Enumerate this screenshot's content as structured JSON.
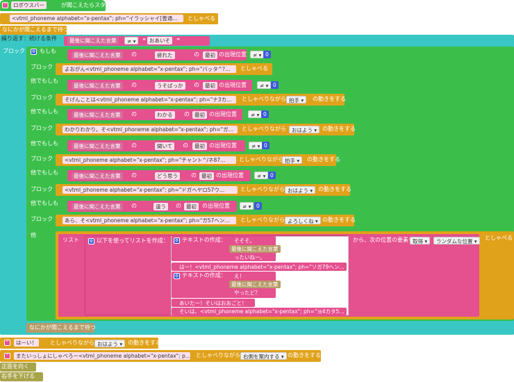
{
  "q": "“",
  "q2": "”",
  "hat": {
    "prefix": "",
    "phrase": "ロボウスバー",
    "suffix": "が聞こえたらスタート"
  },
  "speak1": {
    "text": "<vtml_phoneme alphabet=\"x-pentax\"; ph=\"イラッシャイ[普通…",
    "action": "としゃべる"
  },
  "wait_until": "なにかが聞こえるまで待つ",
  "repeat": {
    "label": "繰り返す：続ける条件",
    "last_heard": "最後に聞こえた言葉",
    "op": "≠",
    "word": "おあいそ"
  },
  "block_label": "ブロック",
  "if_label": "もしも",
  "elif_label": "他でもしも",
  "else_label": "他",
  "of_label": "の",
  "first_label": "最初",
  "pos_label": "の出現位置",
  "neq_label": "≠",
  "zero_label": "0",
  "conds": [
    {
      "word": "疲れた"
    },
    {
      "word": "うそばっか"
    },
    {
      "word": "わかる"
    },
    {
      "word": "聞いて"
    },
    {
      "word": "どう思う"
    },
    {
      "word": "違う"
    }
  ],
  "speaks": [
    {
      "text": "よおがん<vtml_phoneme alphabet=\"x-pentax\"; ph=\"バッタ^?…",
      "action": "としゃべる",
      "motion": ""
    },
    {
      "text": "そげんことは<vtml_phoneme alphabet=\"x-pentax\"; ph=\"ナ3カ…",
      "action": "としゃべりながら",
      "motion": "拍手",
      "tail": "の動きをする"
    },
    {
      "text": "わかりわかり。そ<vtml_phoneme alphabet=\"x-pentax\"; ph=\"ガ…",
      "action": "としゃべりながら",
      "motion": "おはよう",
      "tail": "の動きをする"
    },
    {
      "text": "<vtml_phoneme alphabet=\"x-pentax\"; ph=\"チャント^/ネ87…",
      "action": "としゃべりながら",
      "motion": "拍手",
      "tail": "の動きをする"
    },
    {
      "text": "<vtml_phoneme alphabet=\"x-pentax\"; ph=\"ドガヘヤロ57ウ…",
      "action": "としゃべりながら",
      "motion": "おはよう",
      "tail": "の動きをする"
    },
    {
      "text": "あら、そ<vtml_phoneme alphabet=\"x-pentax\"; ph=\"ガ57ヘン…",
      "action": "としゃべりながら",
      "motion": "よろしくね",
      "tail": "の動きをする"
    }
  ],
  "else_block": {
    "list_label": "リスト",
    "make_list": "以下を使ってリストを作成：",
    "make_text": "テキストの作成：",
    "items": {
      "t1a": "そそそ。",
      "t1b": "最後に聞こえた言葉",
      "t1c": "ったいねー。",
      "s1": "はー！<vtml_phoneme alphabet=\"x-pentax\"; ph=\"ソガ79ヘン…",
      "t2a": "え！",
      "t2b": "最後に聞こえた言葉",
      "t2c": "やったど？",
      "s2": "あいたー！そいはおおごと！",
      "s3": "そいは、<vtml_phoneme alphabet=\"x-pentax\"; ph=\"ヨ4カタ5…"
    },
    "from": "から、次の位置の要素を",
    "get": "取得",
    "random": "ランダムな位置",
    "speak": "としゃべる"
  },
  "wait_until2": "なにかが聞こえるまで待つ",
  "tail1": {
    "text": "はーい！",
    "action": "としゃべりながら",
    "motion": "おはよう",
    "tail": "の動きをする"
  },
  "tail2": {
    "text": "またいっしょにしゃべろー<vtml_phoneme alphabet=\"x-pentax\"; p…",
    "action": "としゃべりながら",
    "motion": "右側を案内する",
    "tail": "の動きをする"
  },
  "face_front": "正面を向く",
  "lower_right": "右手を下げる"
}
